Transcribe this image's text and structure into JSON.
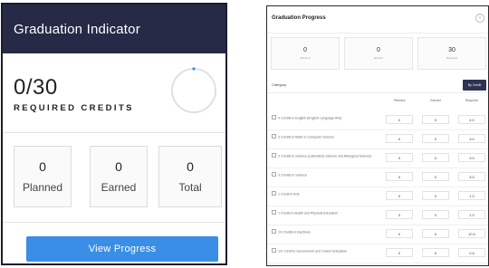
{
  "indicator": {
    "title": "Graduation Indicator",
    "credits_value": "0/30",
    "credits_label": "REQUIRED CREDITS",
    "progress_fraction": 0.0,
    "stats": [
      {
        "value": "0",
        "label": "Planned"
      },
      {
        "value": "0",
        "label": "Earned"
      },
      {
        "value": "0",
        "label": "Total"
      }
    ],
    "view_button": "View Progress",
    "colors": {
      "header": "#262a47",
      "button": "#3a8ee6",
      "ring_track": "#e0e0e0",
      "ring_accent": "#3a8ee6"
    }
  },
  "progress": {
    "title": "Graduation Progress",
    "more_icon": "info-icon",
    "stats": [
      {
        "value": "0",
        "label": "Planned"
      },
      {
        "value": "0",
        "label": "Earned"
      },
      {
        "value": "30",
        "label": "Required"
      }
    ],
    "category_label": "Category",
    "category_button": "By Credit",
    "columns": [
      "Planned",
      "Earned",
      "Required"
    ],
    "rows": [
      {
        "name": "4 Credits in English (English Language Arts)",
        "planned": "0",
        "earned": "0",
        "required": "4.0"
      },
      {
        "name": "3 Credits in Math or Computer Science",
        "planned": "0",
        "earned": "0",
        "required": "3.0"
      },
      {
        "name": "3 Credits in Science (Laboratory Science and Biological Science)",
        "planned": "0",
        "earned": "0",
        "required": "3.0"
      },
      {
        "name": "3 Credits in Science",
        "planned": "0",
        "earned": "0",
        "required": "3.0"
      },
      {
        "name": "1 Credit in Arts",
        "planned": "0",
        "earned": "0",
        "required": "1.0"
      },
      {
        "name": "1 Credit in Health and Physical Education",
        "planned": "0",
        "earned": "0",
        "required": "1.0"
      },
      {
        "name": "10 Credits in Electives",
        "planned": "0",
        "earned": "0",
        "required": "10.0"
      },
      {
        "name": "1/2 Credit in Government and Career Education",
        "planned": "0",
        "earned": "0",
        "required": "0.5"
      }
    ]
  }
}
